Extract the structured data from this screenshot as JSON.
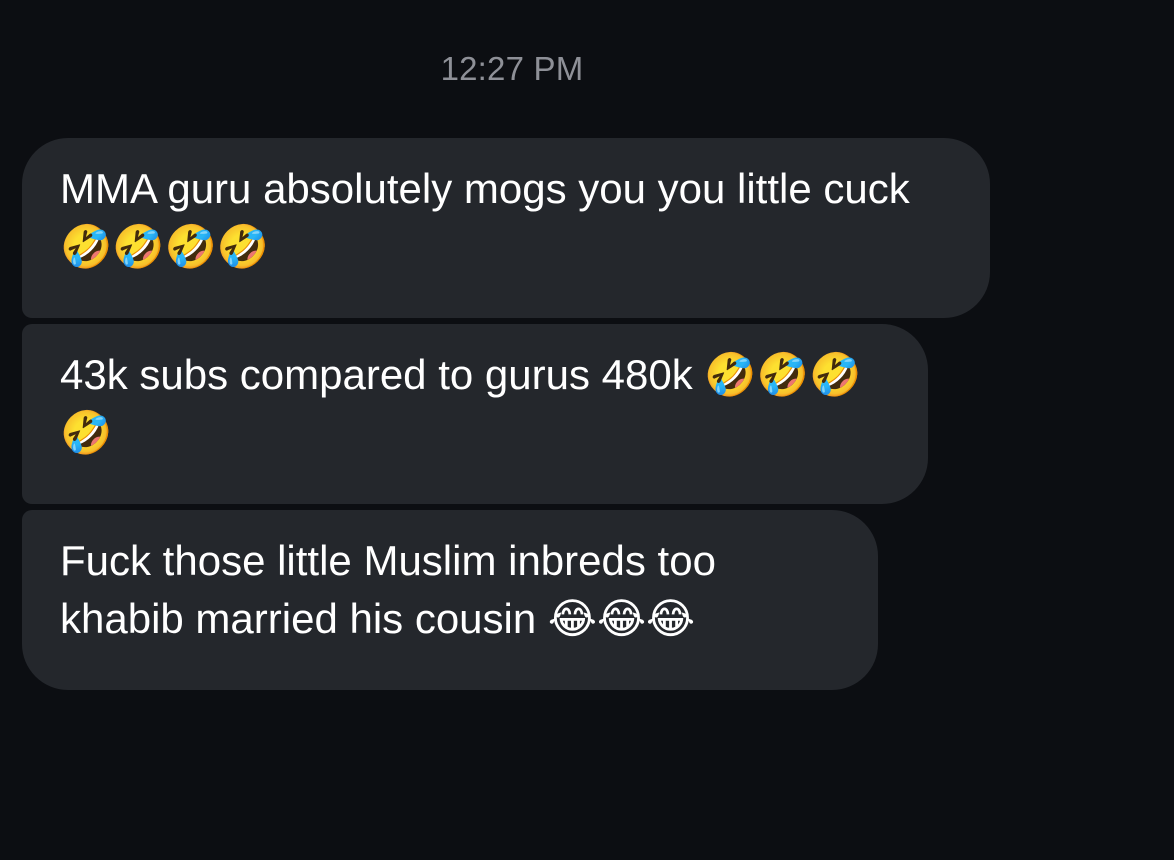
{
  "conversation": {
    "timestamp": "12:27 PM",
    "messages": [
      {
        "text": "MMA guru absolutely mogs you you little cuck 🤣🤣🤣🤣"
      },
      {
        "text": "43k subs compared to gurus 480k 🤣🤣🤣🤣"
      },
      {
        "text": "Fuck those little Muslim inbreds too khabib married his cousin 😂😂😂"
      }
    ]
  },
  "colors": {
    "background": "#0c0e12",
    "bubble": "#24272c",
    "timestamp_text": "#8e9097",
    "message_text": "#ffffff"
  }
}
